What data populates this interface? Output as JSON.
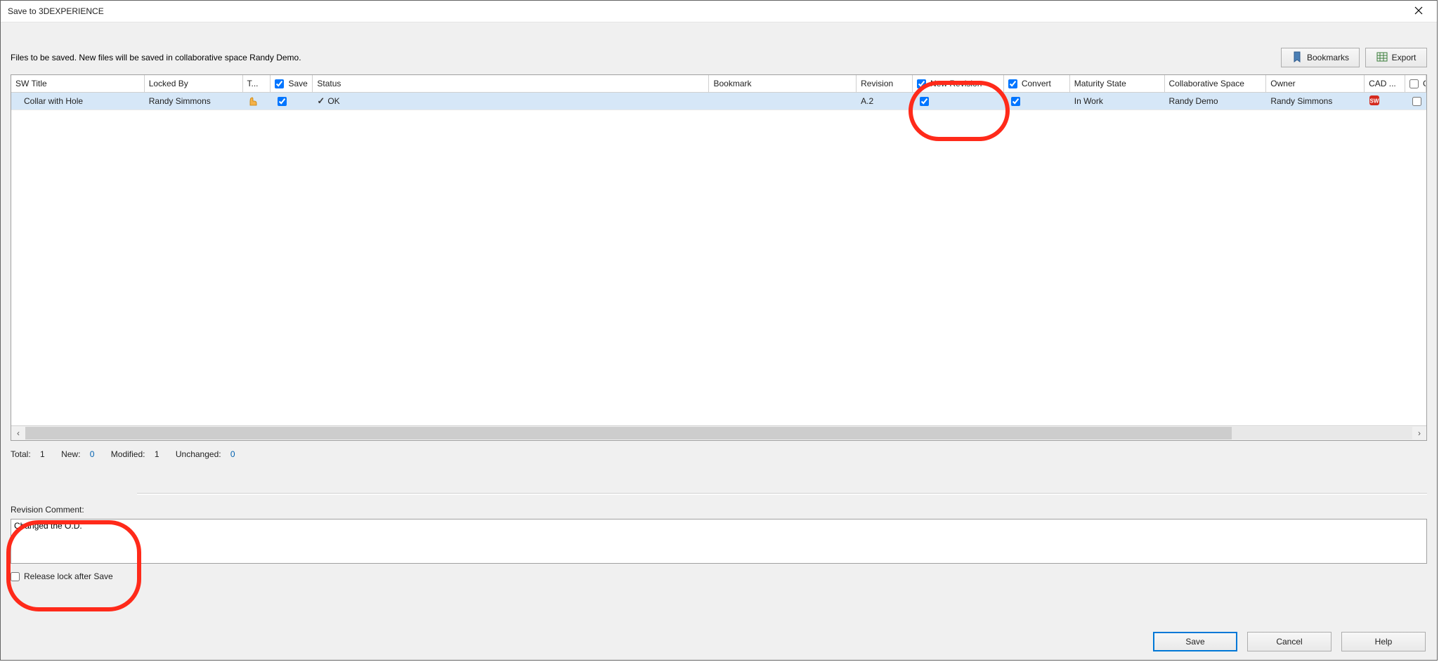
{
  "window": {
    "title": "Save to 3DEXPERIENCE"
  },
  "info_text": "Files to be saved. New files will be saved in collaborative space Randy Demo.",
  "buttons": {
    "bookmarks": "Bookmarks",
    "export": "Export",
    "save": "Save",
    "cancel": "Cancel",
    "help": "Help"
  },
  "columns": {
    "sw_title": "SW Title",
    "locked_by": "Locked By",
    "t": "T...",
    "save": "Save",
    "status": "Status",
    "bookmark": "Bookmark",
    "revision": "Revision",
    "new_revision": "New Revision",
    "convert": "Convert",
    "maturity_state": "Maturity State",
    "collab_space": "Collaborative Space",
    "owner": "Owner",
    "cad": "CAD ...",
    "g": "G"
  },
  "header_checkboxes": {
    "save": true,
    "new_revision": true,
    "convert": true,
    "g": false
  },
  "rows": [
    {
      "sw_title": "Collar with Hole",
      "locked_by": "Randy Simmons",
      "type_icon": "part-icon",
      "save": true,
      "status": "OK",
      "bookmark": "",
      "revision": "A.2",
      "new_revision": true,
      "convert": true,
      "maturity_state": "In Work",
      "collab_space": "Randy Demo",
      "owner": "Randy Simmons",
      "cad_icon": "solidworks-icon",
      "g": false
    }
  ],
  "summary": {
    "total_label": "Total:",
    "total_value": "1",
    "new_label": "New:",
    "new_value": "0",
    "modified_label": "Modified:",
    "modified_value": "1",
    "unchanged_label": "Unchanged:",
    "unchanged_value": "0"
  },
  "revision_comment": {
    "label": "Revision Comment:",
    "value": "Changed the O.D."
  },
  "release_lock": {
    "label": "Release lock after Save",
    "checked": false
  }
}
